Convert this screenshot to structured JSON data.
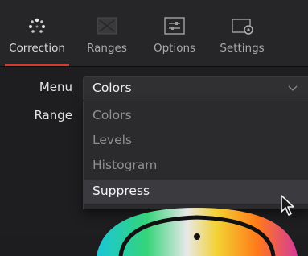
{
  "tabs": [
    {
      "label": "Correction",
      "icon": "color-dots-icon",
      "active": true
    },
    {
      "label": "Ranges",
      "icon": "ranges-icon",
      "active": false
    },
    {
      "label": "Options",
      "icon": "options-icon",
      "active": false
    },
    {
      "label": "Settings",
      "icon": "settings-icon",
      "active": false
    }
  ],
  "form": {
    "menu_label": "Menu",
    "menu_value": "Colors",
    "range_label": "Range"
  },
  "dropdown": {
    "options": [
      "Colors",
      "Levels",
      "Histogram",
      "Suppress"
    ],
    "highlighted": "Suppress"
  },
  "colors": {
    "accent": "#d83a2f",
    "panel": "#1e1e20",
    "toolbar": "#262628"
  }
}
